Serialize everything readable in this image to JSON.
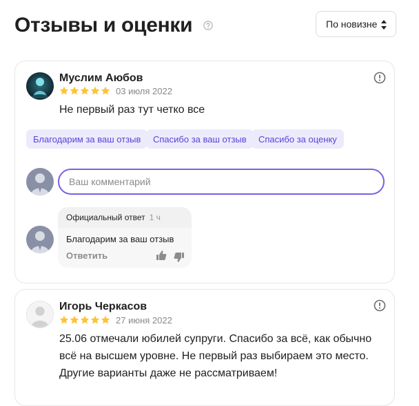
{
  "header": {
    "title": "Отзывы и оценки",
    "help_icon": "question-circle-icon",
    "sort": {
      "value": "По новизне",
      "icon": "sort-arrows-icon"
    }
  },
  "reviews": [
    {
      "author": "Муслим Аюбов",
      "rating": 5,
      "date": "03 июля 2022",
      "text": "Не первый раз тут четко все",
      "report_icon": "exclamation-circle-icon",
      "quick_replies": [
        "Благодарим за ваш отзыв",
        "Спасибо за ваш отзыв",
        "Спасибо за оценку"
      ],
      "comment": {
        "placeholder": "Ваш комментарий",
        "value": ""
      },
      "official_reply": {
        "label": "Официальный ответ",
        "time": "1 ч",
        "text": "Благодарим за ваш отзыв",
        "reply_label": "Ответить"
      }
    },
    {
      "author": "Игорь Черкасов",
      "rating": 5,
      "date": "27 июня 2022",
      "text_lines": [
        "25.06 отмечали юбилей супруги. Спасибо за всё, как обычно",
        "всё на высшем уровне. Не первый раз выбираем это место.",
        "Другие варианты даже не рассматриваем!"
      ],
      "report_icon": "exclamation-circle-icon"
    }
  ],
  "colors": {
    "star": "#fdc23b",
    "accent": "#7a5fe0",
    "chip_bg": "#ecebfc",
    "chip_text": "#5a43d6"
  }
}
